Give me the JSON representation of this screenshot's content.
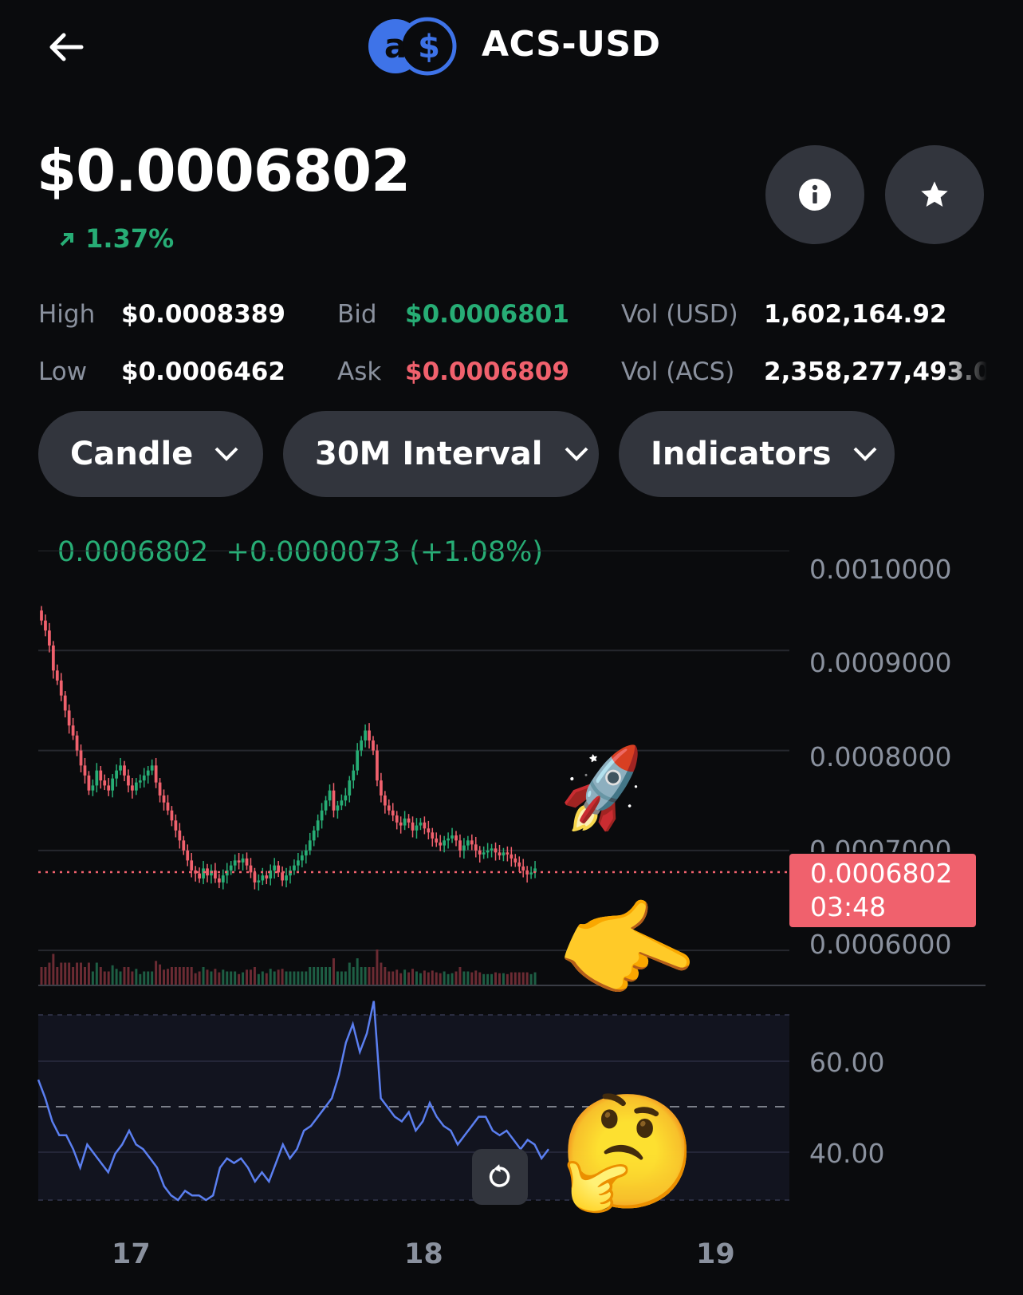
{
  "header": {
    "pair": "ACS-USD",
    "logo_icon": "acs-usd-logo-icon",
    "back_icon": "back-arrow-icon"
  },
  "price": {
    "current": "$0.0006802",
    "change": "1.37%",
    "change_icon": "arrow-up-right-icon",
    "change_color": "#27ad75"
  },
  "actions": {
    "info_icon": "info-icon",
    "star_icon": "star-icon"
  },
  "stats": {
    "high_label": "High",
    "high_value": "$0.0008389",
    "low_label": "Low",
    "low_value": "$0.0006462",
    "bid_label": "Bid",
    "bid_value": "$0.0006801",
    "ask_label": "Ask",
    "ask_value": "$0.0006809",
    "vol_usd_label": "Vol (USD)",
    "vol_usd_value": "1,602,164.92",
    "vol_acs_label": "Vol (ACS)",
    "vol_acs_value": "2,358,277,493.0",
    "bid_color": "#27ad75",
    "ask_color": "#f0616d"
  },
  "controls": {
    "chart_type": "Candle",
    "interval": "30M Interval",
    "indicators": "Indicators"
  },
  "chart_data": {
    "type": "candlestick",
    "legend_price": "0.0006802",
    "legend_change": "+0.0000073 (+1.08%)",
    "price_ticks": [
      "0.0010000",
      "0.0009000",
      "0.0008000",
      "0.0007000",
      "0.0006000"
    ],
    "price_ylim": [
      0.000565,
      0.001
    ],
    "current_price_tag": "0.0006802",
    "countdown": "03:48",
    "rsi_ticks": [
      "60.00",
      "40.00"
    ],
    "rsi_midline": 50,
    "x_dates": [
      "17",
      "18",
      "19"
    ],
    "up_color": "#27ad75",
    "down_color": "#f0616d",
    "rsi_color": "#5b7ff0",
    "close_path": [
      0.00093,
      0.00092,
      0.000905,
      0.00088,
      0.00087,
      0.000855,
      0.00084,
      0.000825,
      0.000815,
      0.0008,
      0.000785,
      0.000775,
      0.00076,
      0.000765,
      0.00078,
      0.00077,
      0.000765,
      0.00076,
      0.000772,
      0.00078,
      0.000785,
      0.000775,
      0.000765,
      0.00076,
      0.000768,
      0.00077,
      0.000775,
      0.00078,
      0.000785,
      0.000768,
      0.000755,
      0.000748,
      0.00074,
      0.00073,
      0.00072,
      0.00071,
      0.0007,
      0.00069,
      0.00068,
      0.000677,
      0.000672,
      0.000682,
      0.000675,
      0.00068,
      0.000672,
      0.000668,
      0.000675,
      0.00068,
      0.000685,
      0.00069,
      0.000688,
      0.000692,
      0.000685,
      0.000678,
      0.000668,
      0.00067,
      0.000675,
      0.000672,
      0.00068,
      0.000685,
      0.000678,
      0.00067,
      0.000675,
      0.00068,
      0.000685,
      0.00069,
      0.000695,
      0.0007,
      0.00071,
      0.00072,
      0.00073,
      0.00074,
      0.00075,
      0.00076,
      0.00074,
      0.000745,
      0.00075,
      0.000755,
      0.00077,
      0.00078,
      0.0008,
      0.00081,
      0.00082,
      0.00081,
      0.0008,
      0.00077,
      0.000755,
      0.000745,
      0.00074,
      0.000735,
      0.000728,
      0.000725,
      0.000732,
      0.000728,
      0.00072,
      0.000725,
      0.000728,
      0.000722,
      0.000718,
      0.000712,
      0.000708,
      0.000705,
      0.00071,
      0.000712,
      0.000715,
      0.00071,
      0.0007,
      0.000705,
      0.00071,
      0.000706,
      0.0007,
      0.000696,
      0.000698,
      0.0007,
      0.000702,
      0.000698,
      0.000695,
      0.000698,
      0.000696,
      0.000692,
      0.000688,
      0.000684,
      0.00068,
      0.000676,
      0.000678,
      0.000682
    ],
    "rsi_path": [
      56,
      52,
      47,
      44,
      44,
      41,
      37,
      42,
      40,
      38,
      36,
      40,
      42,
      45,
      42,
      41,
      39,
      37,
      33,
      31,
      30,
      32,
      31,
      31,
      30,
      31,
      37,
      39,
      38,
      39,
      37,
      34,
      36,
      34,
      38,
      42,
      39,
      41,
      45,
      46,
      48,
      50,
      52,
      57,
      64,
      68,
      62,
      66,
      73,
      52,
      50,
      48,
      47,
      49,
      45,
      47,
      51,
      48,
      46,
      45,
      42,
      44,
      46,
      48,
      48,
      45,
      44,
      45,
      43,
      41,
      43,
      42,
      39,
      41
    ]
  },
  "decor": {
    "rocket_emoji": "🚀",
    "pointing_emoji": "👉",
    "thinking_emoji": "🤔",
    "reset_icon": "reset-icon"
  }
}
